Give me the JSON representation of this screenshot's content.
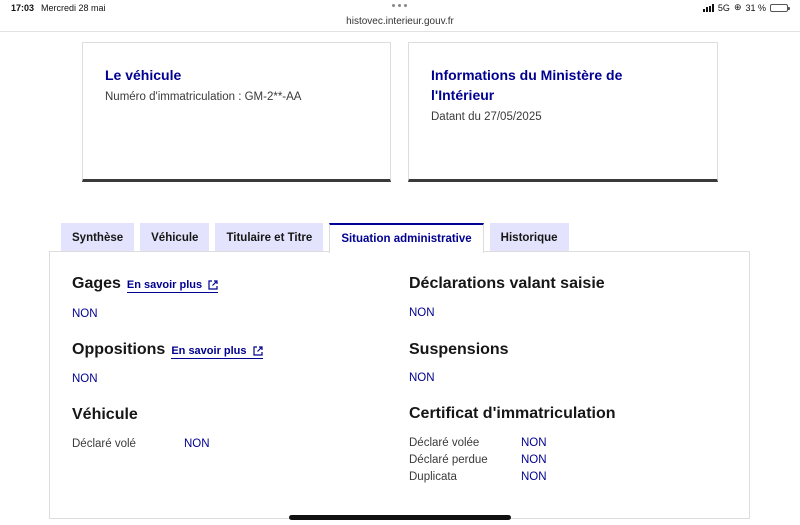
{
  "status_bar": {
    "time": "17:03",
    "date": "Mercredi 28 mai",
    "network": "5G",
    "battery": "31 %",
    "battery_level": 0.31
  },
  "browser": {
    "url": "histovec.interieur.gouv.fr"
  },
  "cards": {
    "vehicle": {
      "title": "Le véhicule",
      "text": "Numéro d'immatriculation : GM-2**-AA"
    },
    "ministry": {
      "title_line1": "Informations du Ministère de",
      "title_line2": "l'Intérieur",
      "text": "Datant du 27/05/2025"
    }
  },
  "tabs": [
    {
      "label": "Synthèse",
      "active": false
    },
    {
      "label": "Véhicule",
      "active": false
    },
    {
      "label": "Titulaire et Titre",
      "active": false
    },
    {
      "label": "Situation administrative",
      "active": true
    },
    {
      "label": "Historique",
      "active": false
    }
  ],
  "panel": {
    "gages": {
      "title": "Gages",
      "link": "En savoir plus",
      "value": "NON"
    },
    "oppositions": {
      "title": "Oppositions",
      "link": "En savoir plus",
      "value": "NON"
    },
    "vehicule": {
      "title": "Véhicule",
      "rows": [
        {
          "label": "Déclaré volé",
          "value": "NON"
        }
      ]
    },
    "saisie": {
      "title": "Déclarations valant saisie",
      "value": "NON"
    },
    "suspensions": {
      "title": "Suspensions",
      "value": "NON"
    },
    "certificat": {
      "title": "Certificat d'immatriculation",
      "rows": [
        {
          "label": "Déclaré volée",
          "value": "NON"
        },
        {
          "label": "Déclaré perdue",
          "value": "NON"
        },
        {
          "label": "Duplicata",
          "value": "NON"
        }
      ]
    }
  },
  "icons": {
    "external_link": "external-link-icon"
  },
  "colors": {
    "accent": "#000091",
    "tab_bg": "#e3e3fd",
    "card_border_bottom": "#3a3a3a"
  }
}
